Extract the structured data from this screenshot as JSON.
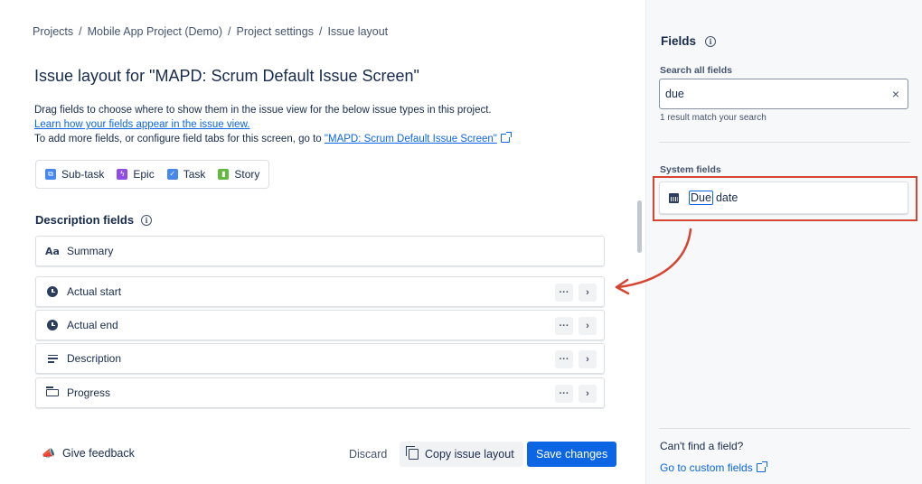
{
  "breadcrumb": {
    "items": [
      "Projects",
      "Mobile App Project (Demo)",
      "Project settings",
      "Issue layout"
    ],
    "separator": "/"
  },
  "page": {
    "title": "Issue layout for \"MAPD: Scrum Default Issue Screen\"",
    "intro_line1": "Drag fields to choose where to show them in the issue view for the below issue types in this project.",
    "learn_link": "Learn how your fields appear in the issue view.",
    "intro_line3": "To add more fields, or configure field tabs for this screen, go to",
    "screen_link": "\"MAPD: Scrum Default Issue Screen\""
  },
  "issue_types": [
    {
      "label": "Sub-task",
      "color": "#4688ec"
    },
    {
      "label": "Epic",
      "color": "#904ee2"
    },
    {
      "label": "Task",
      "color": "#4688ec"
    },
    {
      "label": "Story",
      "color": "#63ba3c"
    }
  ],
  "description_section": {
    "title": "Description fields",
    "fields": [
      {
        "label": "Summary",
        "icon": "text-aa-icon",
        "actions": false
      },
      {
        "label": "Actual start",
        "icon": "clock-icon",
        "actions": true
      },
      {
        "label": "Actual end",
        "icon": "clock-icon",
        "actions": true
      },
      {
        "label": "Description",
        "icon": "paragraph-icon",
        "actions": true
      },
      {
        "label": "Progress",
        "icon": "progress-icon",
        "actions": true
      }
    ],
    "more_label": "···",
    "expand_label": "›"
  },
  "footer": {
    "feedback": "Give feedback",
    "discard": "Discard",
    "copy": "Copy issue layout",
    "save": "Save changes"
  },
  "sidebar": {
    "title": "Fields",
    "search_label": "Search all fields",
    "search_value": "due",
    "clear": "×",
    "match_text": "1 result match your search",
    "system_label": "System fields",
    "result_highlight": "Due",
    "result_rest": "date",
    "cant_find": "Can't find a field?",
    "custom_link": "Go to custom fields"
  },
  "colors": {
    "primary": "#0c66e4",
    "annotation": "#d64534"
  }
}
